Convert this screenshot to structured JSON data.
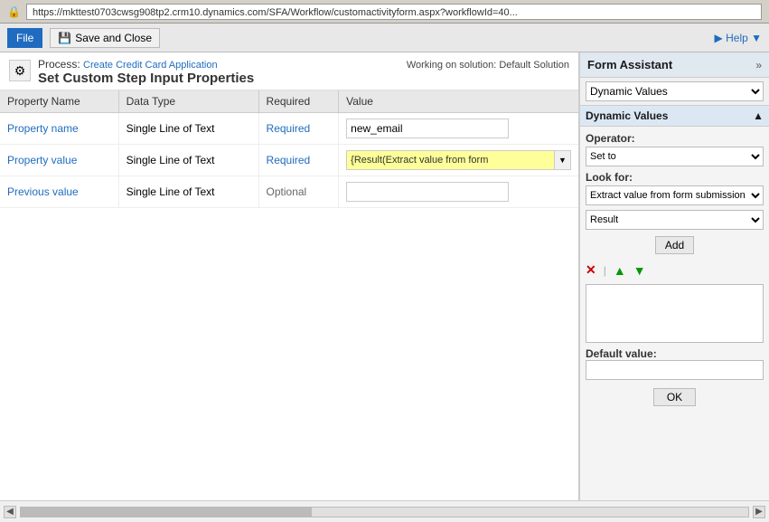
{
  "browser": {
    "url": "https://mkttest0703cwsg908tp2.crm10.dynamics.com/SFA/Workflow/customactivityform.aspx?workflowId=40...",
    "lock_icon": "🔒"
  },
  "toolbar": {
    "file_label": "File",
    "save_close_label": "Save and Close",
    "help_label": "▶ Help ▼"
  },
  "process": {
    "label": "Process:",
    "link_text": "Create Credit Card Application",
    "title": "Set Custom Step Input Properties",
    "solution_text": "Working on solution: Default Solution"
  },
  "table": {
    "headers": [
      "Property Name",
      "Data Type",
      "Required",
      "Value"
    ],
    "rows": [
      {
        "property_name": "Property name",
        "data_type": "Single Line of Text",
        "required": "Required",
        "value": "new_email",
        "value_type": "text"
      },
      {
        "property_name": "Property value",
        "data_type": "Single Line of Text",
        "required": "Required",
        "value": "{Result(Extract value from form",
        "value_type": "highlight"
      },
      {
        "property_name": "Previous value",
        "data_type": "Single Line of Text",
        "required": "Optional",
        "value": "",
        "value_type": "text"
      }
    ]
  },
  "form_assistant": {
    "title": "Form Assistant",
    "expand_icon": "»",
    "dropdown_options": [
      "Dynamic Values"
    ],
    "dropdown_selected": "Dynamic Values",
    "section_label": "Dynamic Values",
    "collapse_icon": "▲",
    "operator_label": "Operator:",
    "operator_options": [
      "Set to"
    ],
    "operator_selected": "Set to",
    "look_for_label": "Look for:",
    "look_for_options": [
      "Extract value from form submission"
    ],
    "look_for_selected": "Extract value from form submission",
    "result_options": [
      "Result"
    ],
    "result_selected": "Result",
    "add_btn_label": "Add",
    "x_btn": "✕",
    "up_btn": "▲",
    "dn_btn": "▼",
    "textarea_value": "",
    "default_value_label": "Default value:",
    "default_value": "",
    "ok_btn_label": "OK"
  }
}
